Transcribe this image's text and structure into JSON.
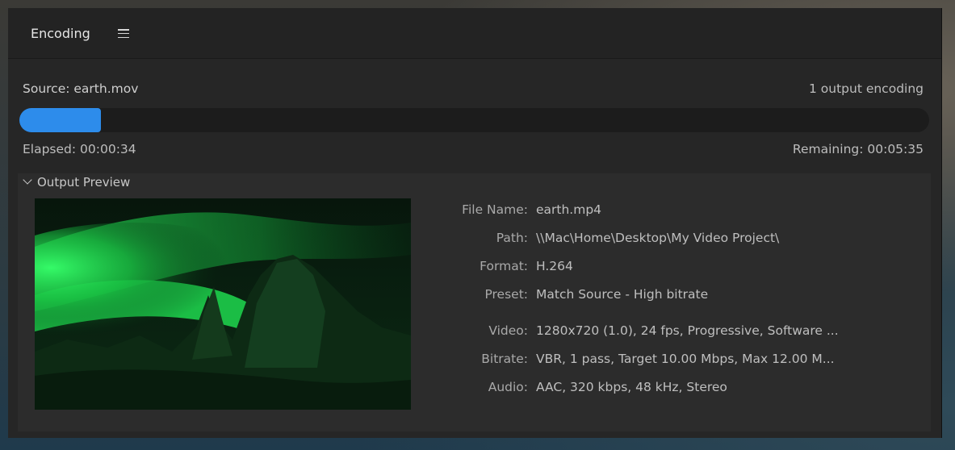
{
  "panel": {
    "title": "Encoding"
  },
  "encoding": {
    "source_label": "Source: earth.mov",
    "outputs_label": "1 output encoding",
    "progress_percent": 9,
    "elapsed_label": "Elapsed: 00:00:34",
    "remaining_label": "Remaining: 00:05:35"
  },
  "preview": {
    "section_label": "Output Preview",
    "properties": [
      {
        "label": "File Name:",
        "value": "earth.mp4"
      },
      {
        "label": "Path:",
        "value": "\\\\Mac\\Home\\Desktop\\My Video Project\\"
      },
      {
        "label": "Format:",
        "value": "H.264"
      },
      {
        "label": "Preset:",
        "value": "Match Source - High bitrate"
      },
      {
        "label": "Video:",
        "value": "1280x720 (1.0), 24 fps, Progressive, Software ..."
      },
      {
        "label": "Bitrate:",
        "value": "VBR, 1 pass, Target 10.00 Mbps, Max 12.00 M..."
      },
      {
        "label": "Audio:",
        "value": "AAC, 320 kbps, 48 kHz, Stereo"
      }
    ]
  },
  "colors": {
    "accent": "#2d8ceb",
    "panel_bg": "#232323",
    "preview_bg": "#2c2c2c",
    "aurora": "#1fd84d"
  },
  "icons": {
    "menu": "hamburger-menu-icon",
    "collapse": "chevron-down-icon"
  }
}
